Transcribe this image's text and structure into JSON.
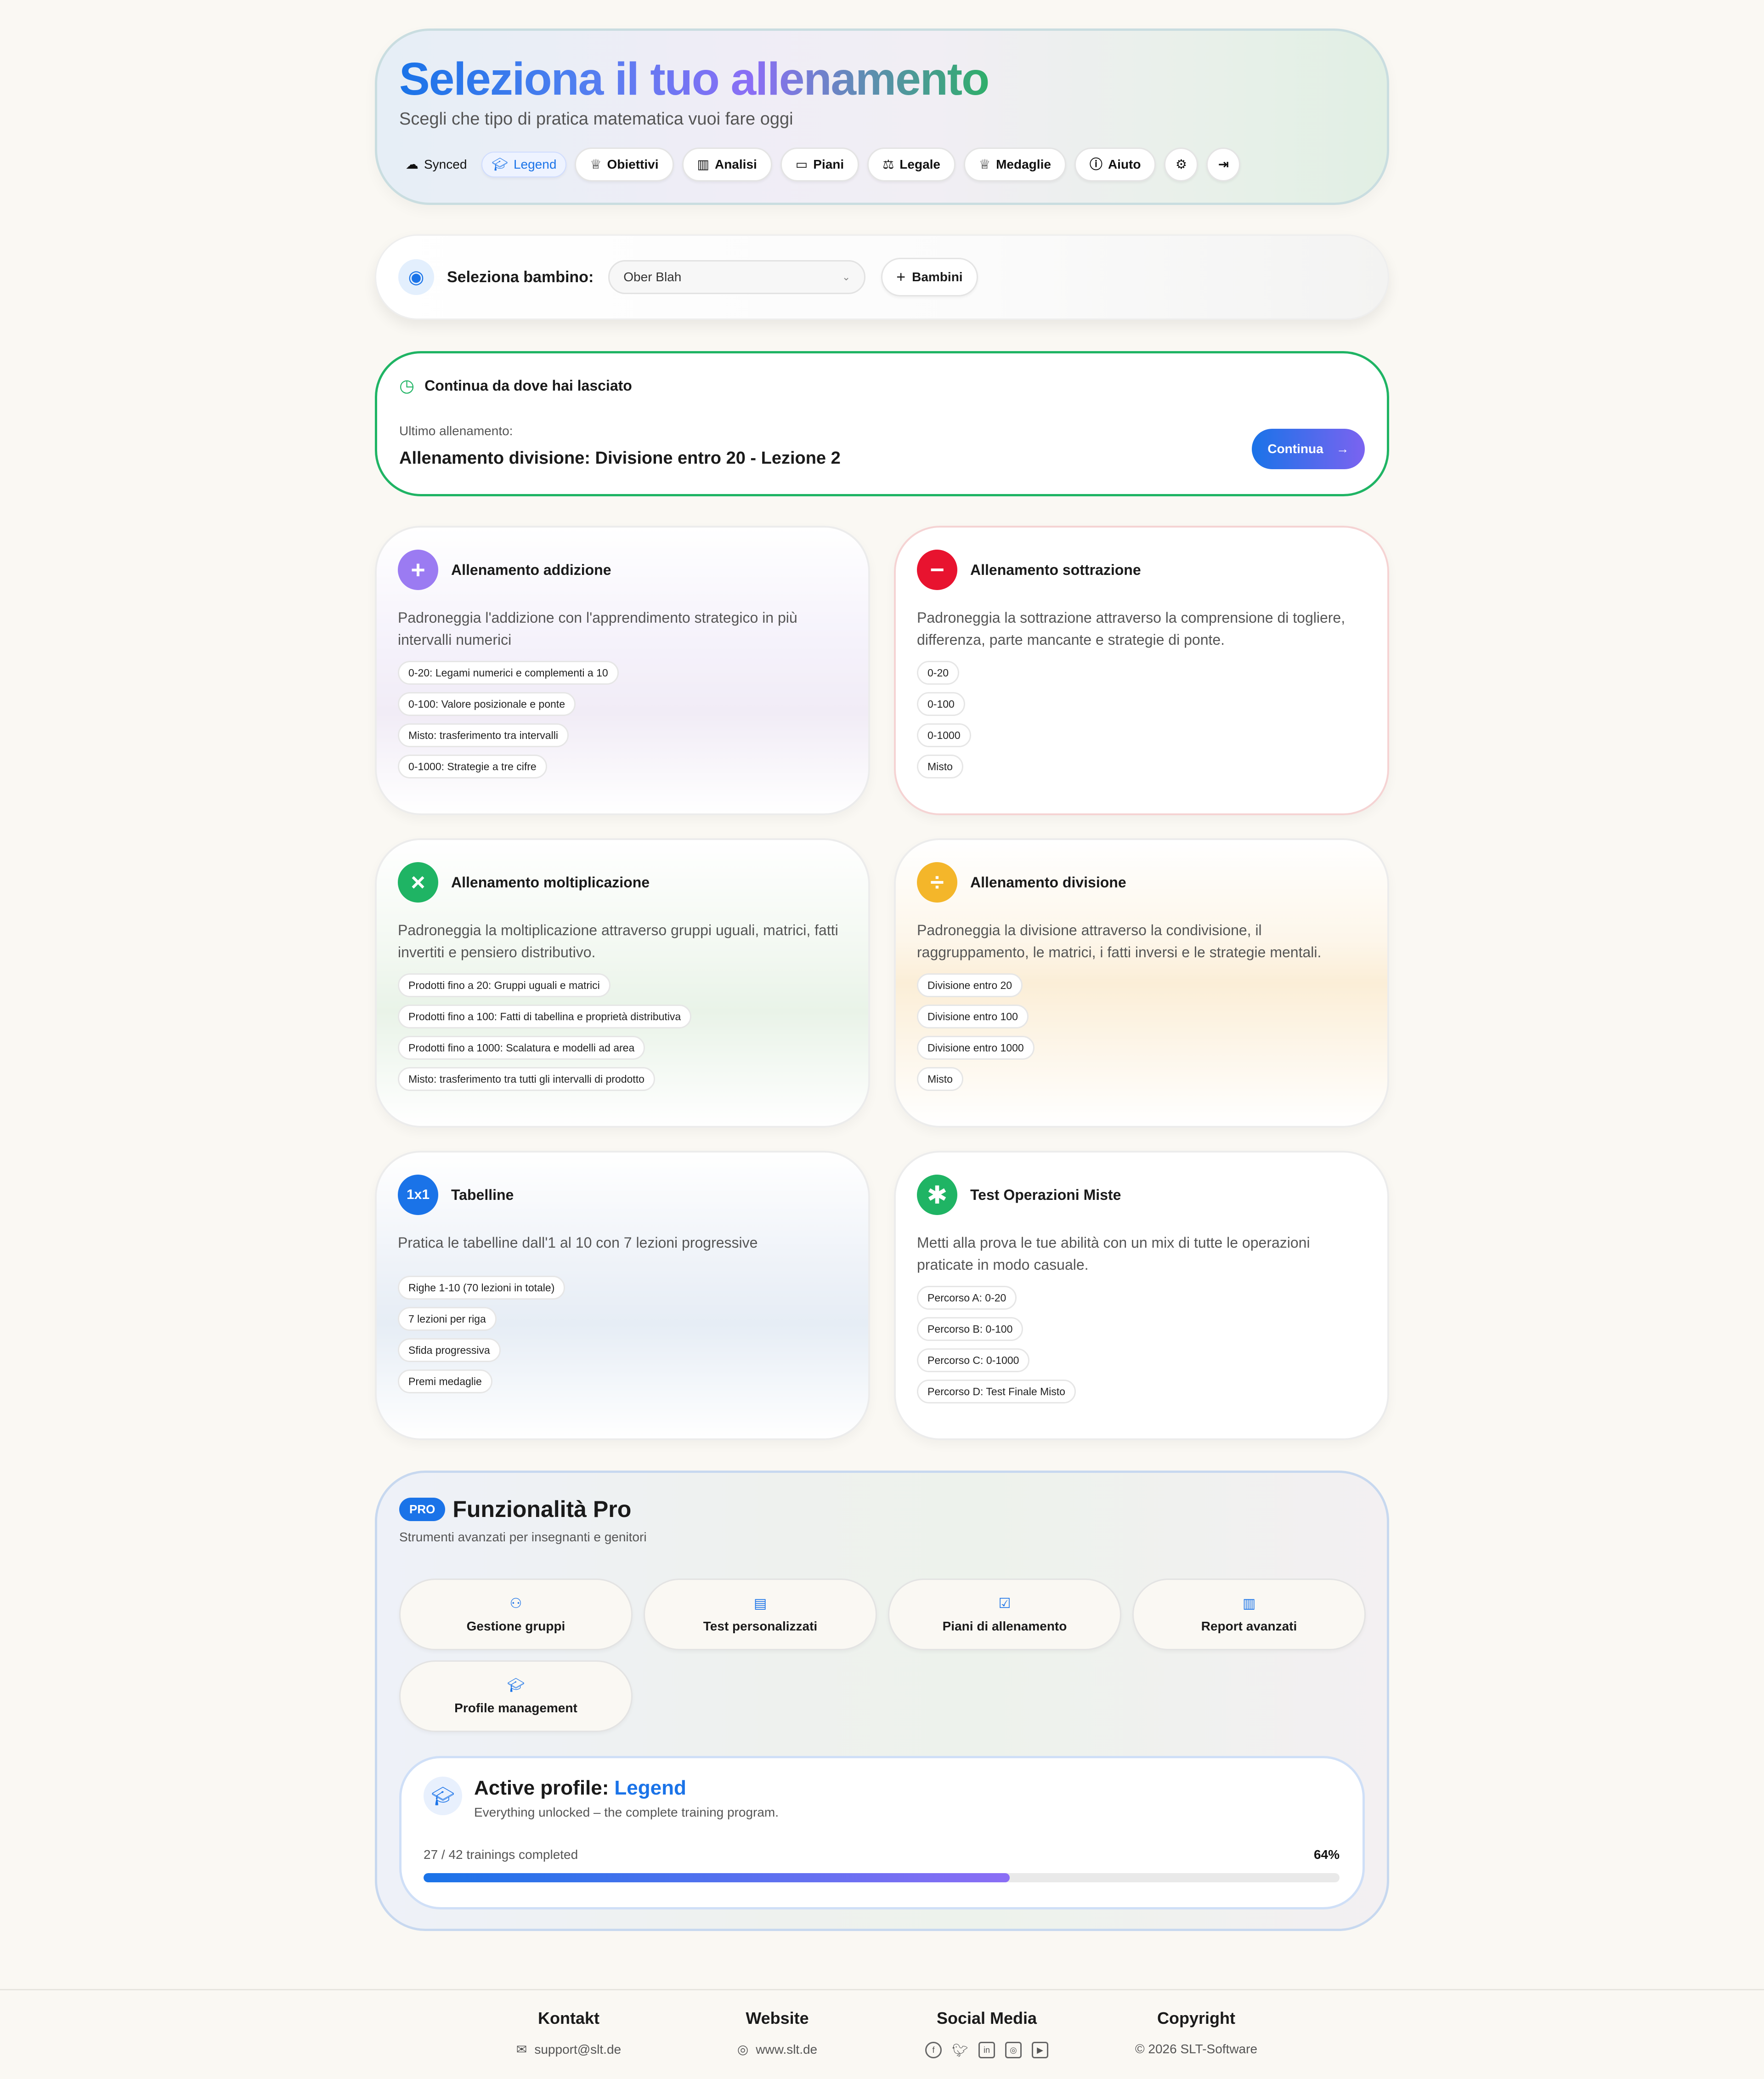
{
  "header": {
    "title": "Seleziona il tuo allenamento",
    "subtitle": "Scegli che tipo di pratica matematica vuoi fare oggi",
    "sync_label": "Synced",
    "level_label": "Legend",
    "nav": [
      {
        "label": "Obiettivi",
        "icon": "trophy-icon"
      },
      {
        "label": "Analisi",
        "icon": "bar-chart-icon"
      },
      {
        "label": "Piani",
        "icon": "card-icon"
      },
      {
        "label": "Legale",
        "icon": "scale-icon"
      },
      {
        "label": "Medaglie",
        "icon": "medal-icon"
      },
      {
        "label": "Aiuto",
        "icon": "help-icon"
      }
    ]
  },
  "child_select": {
    "label": "Seleziona bambino:",
    "selected": "Ober Blah",
    "add_label": "Bambini"
  },
  "continue": {
    "heading": "Continua da dove hai lasciato",
    "last_label": "Ultimo allenamento:",
    "last_title": "Allenamento divisione: Divisione entro 20 - Lezione 2",
    "button": "Continua"
  },
  "cards": [
    {
      "title": "Allenamento addizione",
      "symbol": "+",
      "color": "#9b7bf2",
      "desc": "Padroneggia l'addizione con l'apprendimento strategico in più intervalli numerici",
      "tags": [
        "0-20: Legami numerici e complementi a 10",
        "0-100: Valore posizionale e ponte",
        "Misto: trasferimento tra intervalli",
        "0-1000: Strategie a tre cifre"
      ]
    },
    {
      "title": "Allenamento sottrazione",
      "symbol": "−",
      "color": "#e8132f",
      "desc": "Padroneggia la sottrazione attraverso la comprensione di togliere, differenza, parte mancante e strategie di ponte.",
      "tags": [
        "0-20",
        "0-100",
        "0-1000",
        "Misto"
      ]
    },
    {
      "title": "Allenamento moltiplicazione",
      "symbol": "×",
      "color": "#1fb464",
      "desc": "Padroneggia la moltiplicazione attraverso gruppi uguali, matrici, fatti invertiti e pensiero distributivo.",
      "tags": [
        "Prodotti fino a 20: Gruppi uguali e matrici",
        "Prodotti fino a 100: Fatti di tabellina e proprietà distributiva",
        "Prodotti fino a 1000: Scalatura e modelli ad area",
        "Misto: trasferimento tra tutti gli intervalli di prodotto"
      ]
    },
    {
      "title": "Allenamento divisione",
      "symbol": "÷",
      "color": "#f4b62a",
      "desc": "Padroneggia la divisione attraverso la condivisione, il raggruppamento, le matrici, i fatti inversi e le strategie mentali.",
      "tags": [
        "Divisione entro 20",
        "Divisione entro 100",
        "Divisione entro 1000",
        "Misto"
      ]
    },
    {
      "title": "Tabelline",
      "symbol": "1x1",
      "color": "#1a73e8",
      "desc": "Pratica le tabelline dall'1 al 10 con 7 lezioni progressive",
      "tags": [
        "Righe 1-10 (70 lezioni in totale)",
        "7 lezioni per riga",
        "Sfida progressiva",
        "Premi medaglie"
      ]
    },
    {
      "title": "Test Operazioni Miste",
      "symbol": "✱",
      "color": "#1fb464",
      "desc": "Metti alla prova le tue abilità con un mix di tutte le operazioni praticate in modo casuale.",
      "tags": [
        "Percorso A: 0-20",
        "Percorso B: 0-100",
        "Percorso C: 0-1000",
        "Percorso D: Test Finale Misto"
      ]
    }
  ],
  "pro": {
    "badge": "PRO",
    "title": "Funzionalità Pro",
    "subtitle": "Strumenti avanzati per insegnanti e genitori",
    "features": [
      {
        "label": "Gestione gruppi",
        "icon": "users-icon"
      },
      {
        "label": "Test personalizzati",
        "icon": "document-icon"
      },
      {
        "label": "Piani di allenamento",
        "icon": "clipboard-icon"
      },
      {
        "label": "Report avanzati",
        "icon": "chart-icon"
      },
      {
        "label": "Profile management",
        "icon": "graduation-cap-icon"
      }
    ],
    "profile": {
      "title": "Active profile:",
      "level": "Legend",
      "desc": "Everything unlocked – the complete training program.",
      "progress_text": "27 / 42 trainings completed",
      "percent_text": "64%",
      "progress": 0.64
    }
  },
  "footer": {
    "kontakt_title": "Kontakt",
    "kontakt_value": "support@slt.de",
    "website_title": "Website",
    "website_value": "www.slt.de",
    "social_title": "Social Media",
    "copyright_title": "Copyright",
    "copyright_value": "© 2026 SLT-Software"
  }
}
